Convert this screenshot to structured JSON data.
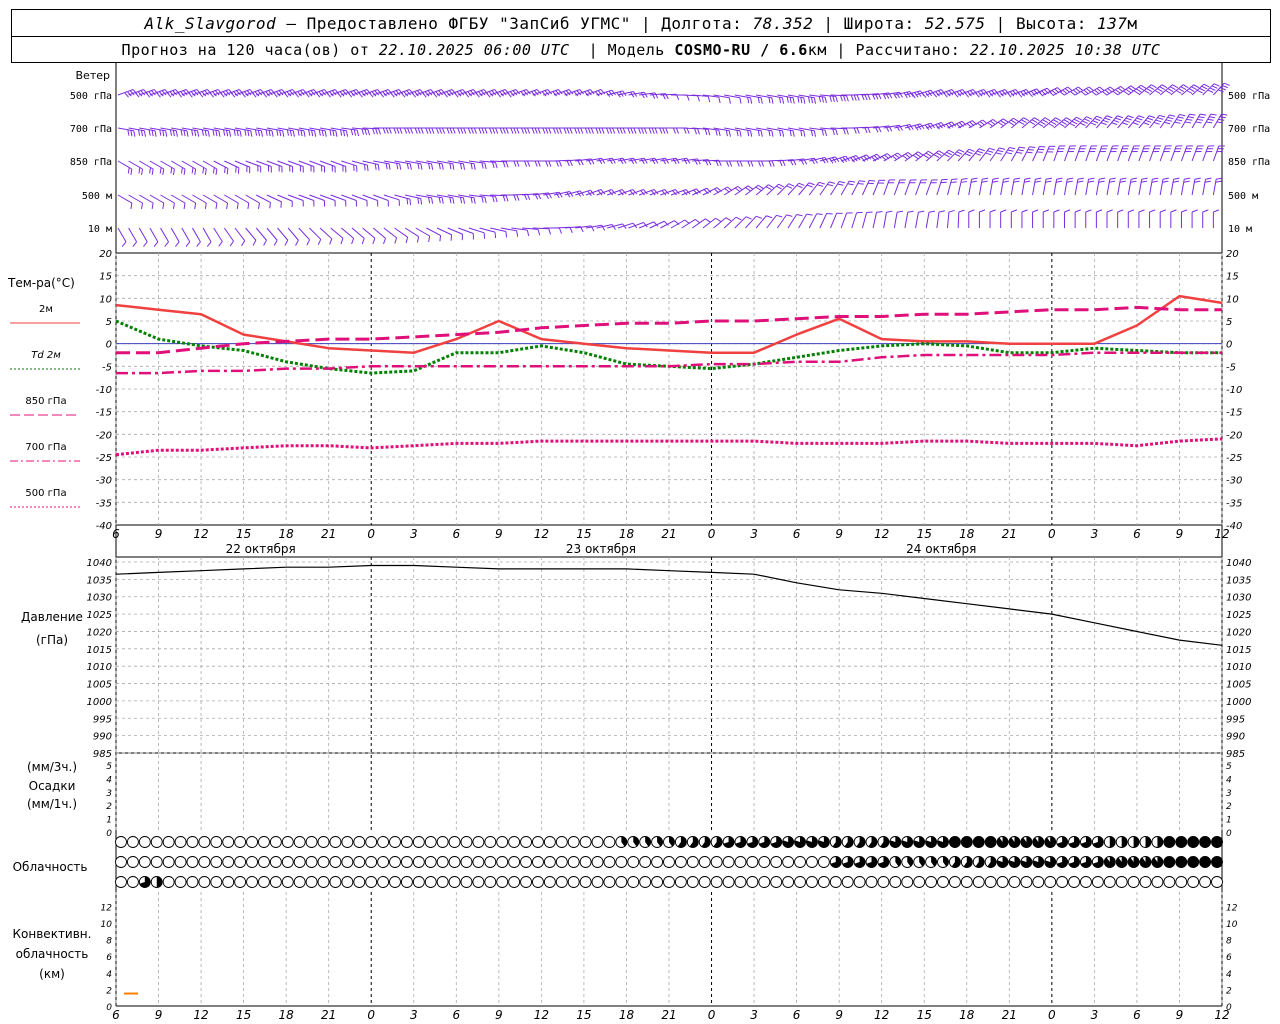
{
  "header": {
    "station": "Alk_Slavgorod",
    "dash": "–",
    "provider": "Предоставлено ФГБУ \"ЗапСиб УГМС\"",
    "lon_label": "Долгота:",
    "lon": "78.352",
    "lat_label": "Широта:",
    "lat": "52.575",
    "alt_label": "Высота:",
    "alt": "137",
    "alt_unit": "м",
    "forecast_label": "Прогноз на 120 часа(ов) от",
    "forecast_time": "22.10.2025 06:00 UTC",
    "model_label": "Модель",
    "model": "COSMO-RU / 6.6",
    "model_unit": "км",
    "calc_label": "Рассчитано:",
    "calc_time": "22.10.2025 10:38 UTC"
  },
  "labels": {
    "wind": "Ветер",
    "wind_levels": [
      "500 гПа",
      "700 гПа",
      "850 гПа",
      "500 м",
      "10 м"
    ],
    "temp_title": "Тем-ра(°C)",
    "legend": [
      {
        "text": "2м",
        "color": "#f04040",
        "style": "solid"
      },
      {
        "text": "Td 2м",
        "color": "#008000",
        "style": "dot"
      },
      {
        "text": "850 гПа",
        "color": "#e0107a",
        "style": "longdash"
      },
      {
        "text": "700 гПа",
        "color": "#e0107a",
        "style": "dashdot"
      },
      {
        "text": "500 гПа",
        "color": "#e0107a",
        "style": "dot"
      }
    ],
    "pressure_title": "Давление",
    "pressure_unit": "(гПа)",
    "precip_unit_top": "(мм/3ч.)",
    "precip_title": "Осадки",
    "precip_unit_bottom": "(мм/1ч.)",
    "cloud_title": "Облачность",
    "conv_title_1": "Конвективн.",
    "conv_title_2": "облачность",
    "conv_unit": "(км)",
    "dates": [
      "22 октября",
      "23 октября",
      "24 октября"
    ]
  },
  "chart_data": [
    {
      "type": "line",
      "title": "Тем-ра(°C)",
      "x_ticks": [
        "6",
        "9",
        "12",
        "15",
        "18",
        "21",
        "0",
        "3",
        "6",
        "9",
        "12",
        "15",
        "18",
        "21",
        "0",
        "3",
        "6",
        "9",
        "12",
        "15",
        "18",
        "21",
        "0",
        "3",
        "6",
        "9",
        "12"
      ],
      "ylim": [
        -40,
        20
      ],
      "yticks": [
        20,
        15,
        10,
        5,
        0,
        -5,
        -10,
        -15,
        -20,
        -25,
        -30,
        -35,
        -40
      ],
      "series": [
        {
          "name": "2м",
          "color": "#f04040",
          "values": [
            8.5,
            7.5,
            6.5,
            2,
            0.5,
            -1,
            -1.5,
            -2,
            1,
            5,
            1,
            0,
            -1,
            -1.5,
            -2,
            -2,
            2,
            5.5,
            1,
            0.5,
            0.5,
            0,
            0,
            0,
            4,
            10.5,
            9
          ]
        },
        {
          "name": "Td 2м",
          "color": "#008000",
          "values": [
            5,
            1,
            -0.5,
            -1.5,
            -4,
            -5.5,
            -6.5,
            -6,
            -2,
            -2,
            -0.5,
            -2,
            -4.5,
            -5,
            -5.5,
            -4.5,
            -3,
            -1.5,
            -0.5,
            0,
            -0.5,
            -2,
            -2,
            -1,
            -1.5,
            -2,
            -2
          ]
        },
        {
          "name": "850 гПа",
          "color": "#e0107a",
          "values": [
            -2,
            -2,
            -1,
            0,
            0.5,
            1,
            1,
            1.5,
            2,
            2.5,
            3.5,
            4,
            4.5,
            4.5,
            5,
            5,
            5.5,
            6,
            6,
            6.5,
            6.5,
            7,
            7.5,
            7.5,
            8,
            7.5,
            7.5
          ]
        },
        {
          "name": "700 гПа",
          "color": "#e0107a",
          "values": [
            -6.5,
            -6.5,
            -6,
            -6,
            -5.5,
            -5.5,
            -5,
            -5,
            -5,
            -5,
            -5,
            -5,
            -5,
            -5,
            -4.5,
            -4.5,
            -4,
            -4,
            -3,
            -2.5,
            -2.5,
            -2.5,
            -2.5,
            -2,
            -2,
            -2,
            -2
          ]
        },
        {
          "name": "500 гПа",
          "color": "#e0107a",
          "values": [
            -24.5,
            -23.5,
            -23.5,
            -23,
            -22.5,
            -22.5,
            -23,
            -22.5,
            -22,
            -22,
            -21.5,
            -21.5,
            -21.5,
            -21.5,
            -21.5,
            -21.5,
            -22,
            -22,
            -22,
            -21.5,
            -21.5,
            -22,
            -22,
            -22,
            -22.5,
            -21.5,
            -21
          ]
        }
      ]
    },
    {
      "type": "line",
      "title": "Давление",
      "ylabel": "(гПа)",
      "ylim": [
        985,
        1040
      ],
      "yticks": [
        1040,
        1035,
        1030,
        1025,
        1020,
        1015,
        1010,
        1005,
        1000,
        995,
        990,
        985
      ],
      "series": [
        {
          "name": "Давление",
          "color": "#000000",
          "values": [
            1036.5,
            1037,
            1037.5,
            1038,
            1038.5,
            1038.5,
            1039,
            1039,
            1038.5,
            1038,
            1038,
            1038,
            1038,
            1037.5,
            1037,
            1036.5,
            1034,
            1032,
            1031,
            1029.5,
            1028,
            1026.5,
            1025,
            1022.5,
            1020,
            1017.5,
            1016
          ]
        }
      ]
    },
    {
      "type": "bar",
      "title": "Осадки",
      "ylim": [
        0,
        5
      ],
      "yticks": [
        5,
        4,
        3,
        2,
        1,
        0
      ],
      "values": []
    },
    {
      "type": "scatter",
      "title": "Облачность",
      "rows": 3,
      "steps_per_hour": 1,
      "levels": {
        "top": [
          [
            0,
            0
          ],
          [
            48,
            0
          ],
          [
            54,
            0.4
          ],
          [
            60,
            0.6
          ],
          [
            66,
            0.7
          ],
          [
            72,
            0.8
          ],
          [
            78,
            0.6
          ],
          [
            84,
            0.8
          ],
          [
            90,
            1
          ],
          [
            96,
            0.9
          ],
          [
            102,
            0.7
          ],
          [
            108,
            0.5
          ],
          [
            114,
            1
          ],
          [
            120,
            1
          ]
        ],
        "middle": [
          [
            0,
            0
          ],
          [
            60,
            0
          ],
          [
            66,
            0
          ],
          [
            72,
            0
          ],
          [
            78,
            0.7
          ],
          [
            84,
            0.4
          ],
          [
            90,
            0.6
          ],
          [
            96,
            0.8
          ],
          [
            102,
            0.7
          ],
          [
            108,
            0.9
          ],
          [
            114,
            1
          ],
          [
            120,
            1
          ]
        ],
        "bottom": [
          [
            0,
            0
          ],
          [
            2,
            0.7
          ],
          [
            3,
            0.5
          ],
          [
            4,
            0
          ],
          [
            120,
            0
          ]
        ]
      }
    },
    {
      "type": "bar",
      "title": "Конвективн. облачность",
      "ylim": [
        0,
        13
      ],
      "yticks": [
        12,
        10,
        8,
        6,
        4,
        2,
        0
      ],
      "values": [
        [
          1,
          1.5
        ]
      ]
    }
  ],
  "colors": {
    "wind": "#7a2be0",
    "grid": "#999999",
    "conv": "#ff8000"
  },
  "wind_data": {
    "levels": [
      "500 гПа",
      "700 гПа",
      "850 гПа",
      "500 м",
      "10 м"
    ],
    "dir_deg": [
      [
        250,
        250,
        250,
        250,
        250,
        250,
        250,
        250,
        250,
        250,
        250,
        250,
        260,
        270,
        280,
        280,
        280,
        270,
        260,
        250,
        250,
        250,
        240,
        240,
        230,
        230,
        220
      ],
      [
        280,
        280,
        280,
        280,
        280,
        280,
        270,
        270,
        270,
        270,
        270,
        270,
        270,
        270,
        280,
        280,
        280,
        270,
        260,
        250,
        240,
        230,
        230,
        220,
        220,
        210,
        210
      ],
      [
        300,
        300,
        300,
        290,
        290,
        290,
        280,
        280,
        280,
        270,
        270,
        260,
        260,
        260,
        270,
        270,
        260,
        250,
        240,
        230,
        220,
        210,
        200,
        200,
        200,
        200,
        200
      ],
      [
        300,
        300,
        300,
        300,
        290,
        290,
        290,
        280,
        280,
        270,
        260,
        250,
        250,
        250,
        240,
        230,
        220,
        210,
        200,
        200,
        190,
        190,
        190,
        190,
        190,
        190,
        190
      ],
      [
        330,
        330,
        330,
        320,
        320,
        310,
        310,
        300,
        290,
        280,
        270,
        260,
        250,
        240,
        230,
        220,
        210,
        200,
        190,
        190,
        180,
        180,
        180,
        180,
        180,
        180,
        180
      ]
    ],
    "speed_ms": [
      [
        20,
        20,
        20,
        20,
        20,
        20,
        18,
        18,
        18,
        18,
        15,
        15,
        10,
        5,
        5,
        10,
        15,
        15,
        15,
        20,
        20,
        20,
        20,
        25,
        25,
        25,
        25
      ],
      [
        15,
        15,
        15,
        15,
        15,
        15,
        15,
        15,
        15,
        15,
        15,
        15,
        15,
        10,
        10,
        10,
        10,
        10,
        10,
        15,
        15,
        15,
        20,
        20,
        20,
        20,
        20
      ],
      [
        10,
        10,
        10,
        10,
        10,
        10,
        10,
        10,
        10,
        10,
        10,
        10,
        10,
        10,
        10,
        10,
        10,
        15,
        15,
        15,
        15,
        15,
        15,
        15,
        15,
        15,
        15
      ],
      [
        5,
        5,
        5,
        5,
        5,
        5,
        5,
        10,
        10,
        10,
        10,
        10,
        10,
        10,
        10,
        10,
        10,
        10,
        10,
        10,
        10,
        10,
        10,
        10,
        10,
        10,
        10
      ],
      [
        5,
        5,
        5,
        5,
        5,
        5,
        5,
        5,
        5,
        5,
        5,
        5,
        5,
        5,
        5,
        5,
        5,
        5,
        5,
        5,
        5,
        5,
        5,
        5,
        5,
        5,
        5
      ]
    ]
  }
}
